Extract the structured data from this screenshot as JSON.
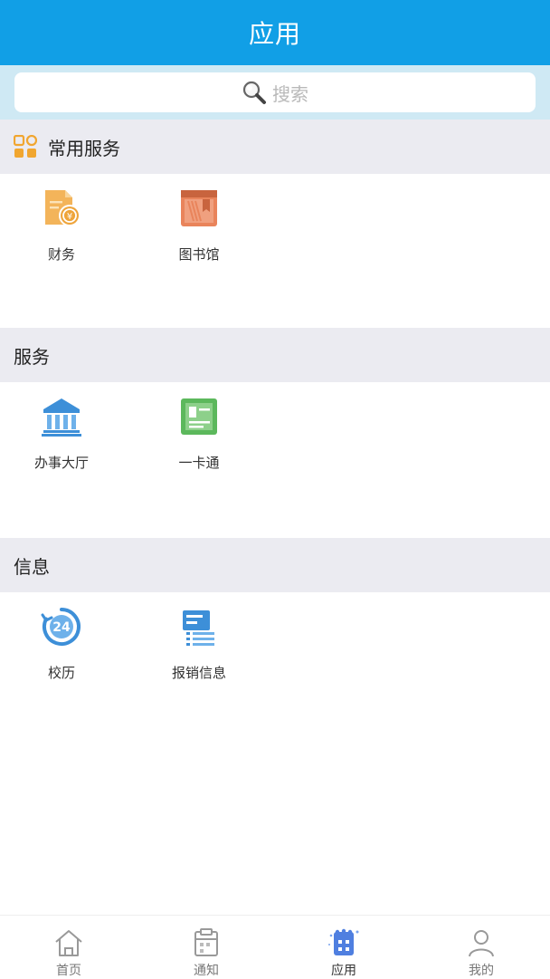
{
  "header": {
    "title": "应用"
  },
  "search": {
    "placeholder": "搜索"
  },
  "sections": [
    {
      "title": "常用服务",
      "items": [
        {
          "label": "财务",
          "icon": "finance-icon"
        },
        {
          "label": "图书馆",
          "icon": "library-book-icon"
        }
      ]
    },
    {
      "title": "服务",
      "items": [
        {
          "label": "办事大厅",
          "icon": "service-hall-icon"
        },
        {
          "label": "一卡通",
          "icon": "campus-card-icon"
        }
      ]
    },
    {
      "title": "信息",
      "items": [
        {
          "label": "校历",
          "icon": "calendar-24-icon"
        },
        {
          "label": "报销信息",
          "icon": "reimbursement-list-icon"
        }
      ]
    }
  ],
  "tabbar": {
    "active": "应用",
    "tabs": [
      {
        "label": "首页",
        "icon": "home-icon"
      },
      {
        "label": "通知",
        "icon": "notice-icon"
      },
      {
        "label": "应用",
        "icon": "apps-icon"
      },
      {
        "label": "我的",
        "icon": "profile-icon"
      }
    ]
  },
  "colors": {
    "header_bg": "#119fe6",
    "search_band": "#cfe9f4",
    "section_bg": "#ebebf1",
    "active_tab_icon": "#4f7fe0"
  }
}
